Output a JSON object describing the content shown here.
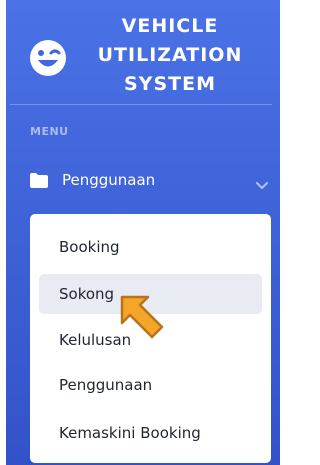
{
  "brand": {
    "title_line1": "VEHICLE",
    "title_line2": "UTILIZATION",
    "title_line3": "SYSTEM",
    "icon": "grin-wink-icon"
  },
  "menu_heading": "MENU",
  "nav": {
    "label": "Penggunaan",
    "icon": "folder-icon",
    "expanded": true,
    "submenu": [
      {
        "label": "Booking"
      },
      {
        "label": "Sokong",
        "active": true
      },
      {
        "label": "Kelulusan"
      },
      {
        "label": "Penggunaan"
      },
      {
        "label": "Kemaskini Booking"
      }
    ]
  },
  "colors": {
    "sidebar_gradient_top": "#4a72e6",
    "sidebar_gradient_bottom": "#3352c9",
    "active_item_bg": "#e8ebf1",
    "cursor_fill": "#f4a52a"
  }
}
